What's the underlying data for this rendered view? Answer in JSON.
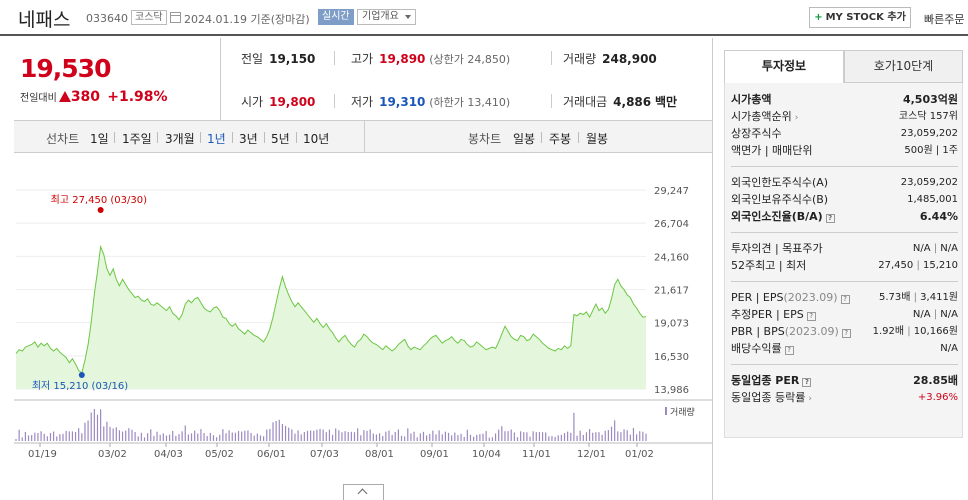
{
  "header": {
    "name": "네패스",
    "code": "033640",
    "market": "코스닥",
    "date": "2024.01.19",
    "basis": "기준(장마감)",
    "realtime": "실시간",
    "company_info": "기업개요",
    "my_stock": "MY STOCK 추가",
    "quick_order": "빠른주문"
  },
  "price": {
    "current": "19,530",
    "change_label": "전일대비",
    "change": "380",
    "pct": "+1.98%",
    "color_up": "#d0021b"
  },
  "summary": {
    "prev_label": "전일",
    "prev": "19,150",
    "high_label": "고가",
    "high": "19,890",
    "upper_limit": "(상한가 24,850)",
    "volume_label": "거래량",
    "volume": "248,900",
    "open_label": "시가",
    "open": "19,800",
    "low_label": "저가",
    "low": "19,310",
    "lower_limit": "(하한가 13,410)",
    "amount_label": "거래대금",
    "amount": "4,886",
    "amount_unit": "백만"
  },
  "period_tabs": {
    "line_label": "선차트",
    "items": [
      "1일",
      "1주일",
      "3개월",
      "1년",
      "3년",
      "5년",
      "10년"
    ],
    "selected": "1년",
    "candle_label": "봉차트",
    "candle_items": [
      "일봉",
      "주봉",
      "월봉"
    ]
  },
  "chart_data": {
    "type": "area",
    "x_ticks": [
      "01/19",
      "03/02",
      "04/03",
      "05/02",
      "06/01",
      "07/03",
      "08/01",
      "09/01",
      "10/04",
      "11/01",
      "12/01",
      "01/02"
    ],
    "y_ticks": [
      29247,
      26704,
      24160,
      21617,
      19073,
      16530,
      13986
    ],
    "ylim": [
      13986,
      29247
    ],
    "high_annotation": "최고 27,450 (03/30)",
    "low_annotation": "최저 15,210 (03/16)",
    "volume_label": "거래량",
    "line_color": "#6cc644",
    "fill_color": "#e4f6dc",
    "y": [
      16700,
      17000,
      16900,
      17200,
      17300,
      17400,
      17600,
      17200,
      17500,
      17300,
      17500,
      17100,
      16900,
      17100,
      16800,
      16600,
      16400,
      16000,
      16300,
      15900,
      15400,
      15210,
      16200,
      17400,
      19100,
      21300,
      23000,
      24900,
      24300,
      23200,
      22700,
      23200,
      22400,
      21900,
      22400,
      22000,
      21600,
      21300,
      21000,
      21100,
      20800,
      20700,
      20900,
      20500,
      20400,
      20600,
      20400,
      20200,
      20000,
      20300,
      19800,
      19600,
      19300,
      19700,
      20500,
      20800,
      20600,
      20900,
      21000,
      20600,
      20200,
      20000,
      19900,
      20200,
      20300,
      20000,
      19500,
      19400,
      19000,
      18800,
      19000,
      18600,
      18400,
      18200,
      18500,
      18300,
      18100,
      18000,
      17800,
      17600,
      18000,
      18600,
      19500,
      20600,
      21700,
      22600,
      21800,
      21200,
      20700,
      20300,
      20600,
      20300,
      20000,
      19700,
      19400,
      19100,
      19400,
      19000,
      18700,
      19000,
      18600,
      18300,
      17900,
      17600,
      17900,
      18100,
      17700,
      17400,
      17200,
      17600,
      17800,
      18200,
      18000,
      17700,
      17500,
      17400,
      17200,
      17000,
      17300,
      17100,
      16900,
      17100,
      17400,
      17600,
      17800,
      17300,
      17000,
      17200,
      17100,
      17000,
      17300,
      17500,
      17800,
      18000,
      18100,
      17800,
      17500,
      17700,
      17800,
      18000,
      17700,
      17500,
      17800,
      17700,
      17400,
      17200,
      17300,
      17600,
      17400,
      17200,
      17000,
      17100,
      17200,
      17100,
      17600,
      18200,
      18800,
      18400,
      18000,
      17800,
      17700,
      18100,
      18000,
      17700,
      17800,
      18200,
      18000,
      17800,
      17500,
      17300,
      17100,
      17000,
      16900,
      17100,
      17000,
      17300,
      17100,
      17300,
      19700,
      19600,
      19800,
      19700,
      19900,
      19500,
      20000,
      20500,
      20000,
      20200,
      19800,
      20100,
      20900,
      22000,
      22400,
      21900,
      21600,
      21200,
      21000,
      20500,
      20200,
      19800,
      19500,
      19530
    ]
  },
  "right_panel": {
    "tabs": [
      "투자정보",
      "호가10단계"
    ],
    "market_cap_label": "시가총액",
    "market_cap": "4,503억원",
    "cap_rank_label": "시가총액순위",
    "cap_rank": "코스닥 157위",
    "shares_label": "상장주식수",
    "shares": "23,059,202",
    "par_label": "액면가 | 매매단위",
    "par": "500원 | 1주",
    "foreign_limit_label": "외국인한도주식수(A)",
    "foreign_limit": "23,059,202",
    "foreign_hold_label": "외국인보유주식수(B)",
    "foreign_hold": "1,485,001",
    "foreign_ratio_label": "외국인소진율(B/A)",
    "foreign_ratio": "6.44%",
    "opinion_label": "투자의견 | 목표주가",
    "opinion": "N/A",
    "target": "N/A",
    "w52_label": "52주최고 | 최저",
    "w52_high": "27,450",
    "w52_low": "15,210",
    "per_label": "PER | EPS",
    "per_period": "(2023.09)",
    "per": "5.73배",
    "eps": "3,411원",
    "est_label": "추정PER | EPS",
    "est_per": "N/A",
    "est_eps": "N/A",
    "pbr_label": "PBR | BPS",
    "pbr_period": "(2023.09)",
    "pbr": "1.92배",
    "bps": "10,166원",
    "div_label": "배당수익률",
    "div": "N/A",
    "ind_per_label": "동일업종 PER",
    "ind_per": "28.85배",
    "ind_rate_label": "동일업종 등락률",
    "ind_rate": "+3.96%"
  }
}
